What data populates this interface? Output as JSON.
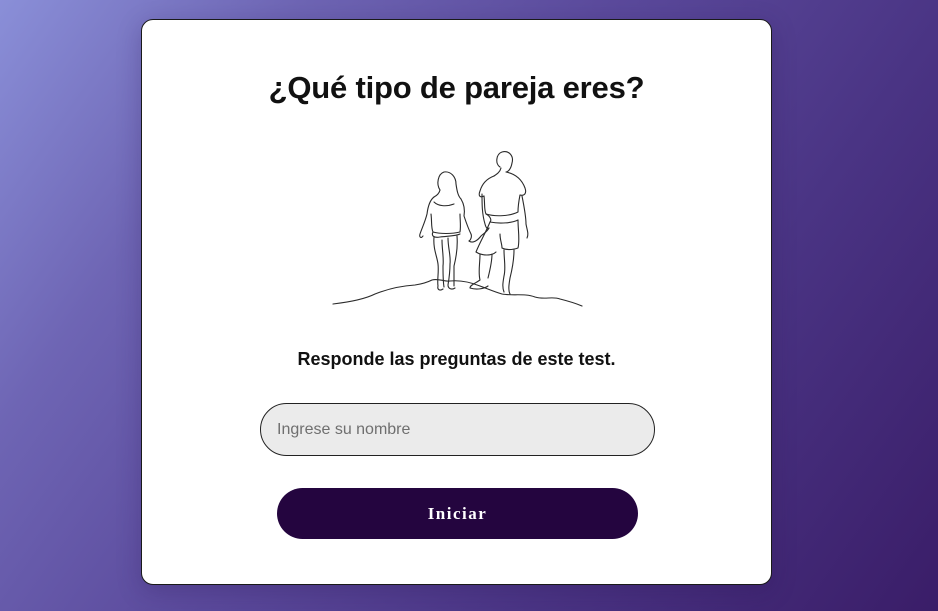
{
  "card": {
    "title": "¿Qué tipo de pareja eres?",
    "subtitle": "Responde las preguntas de este test.",
    "illustration_icon": "couple-line-drawing-icon"
  },
  "form": {
    "name_placeholder": "Ingrese su nombre",
    "name_value": "",
    "start_label": "Iniciar"
  },
  "colors": {
    "button_bg": "#24053f",
    "input_bg": "#ebebeb",
    "card_bg": "#ffffff"
  }
}
